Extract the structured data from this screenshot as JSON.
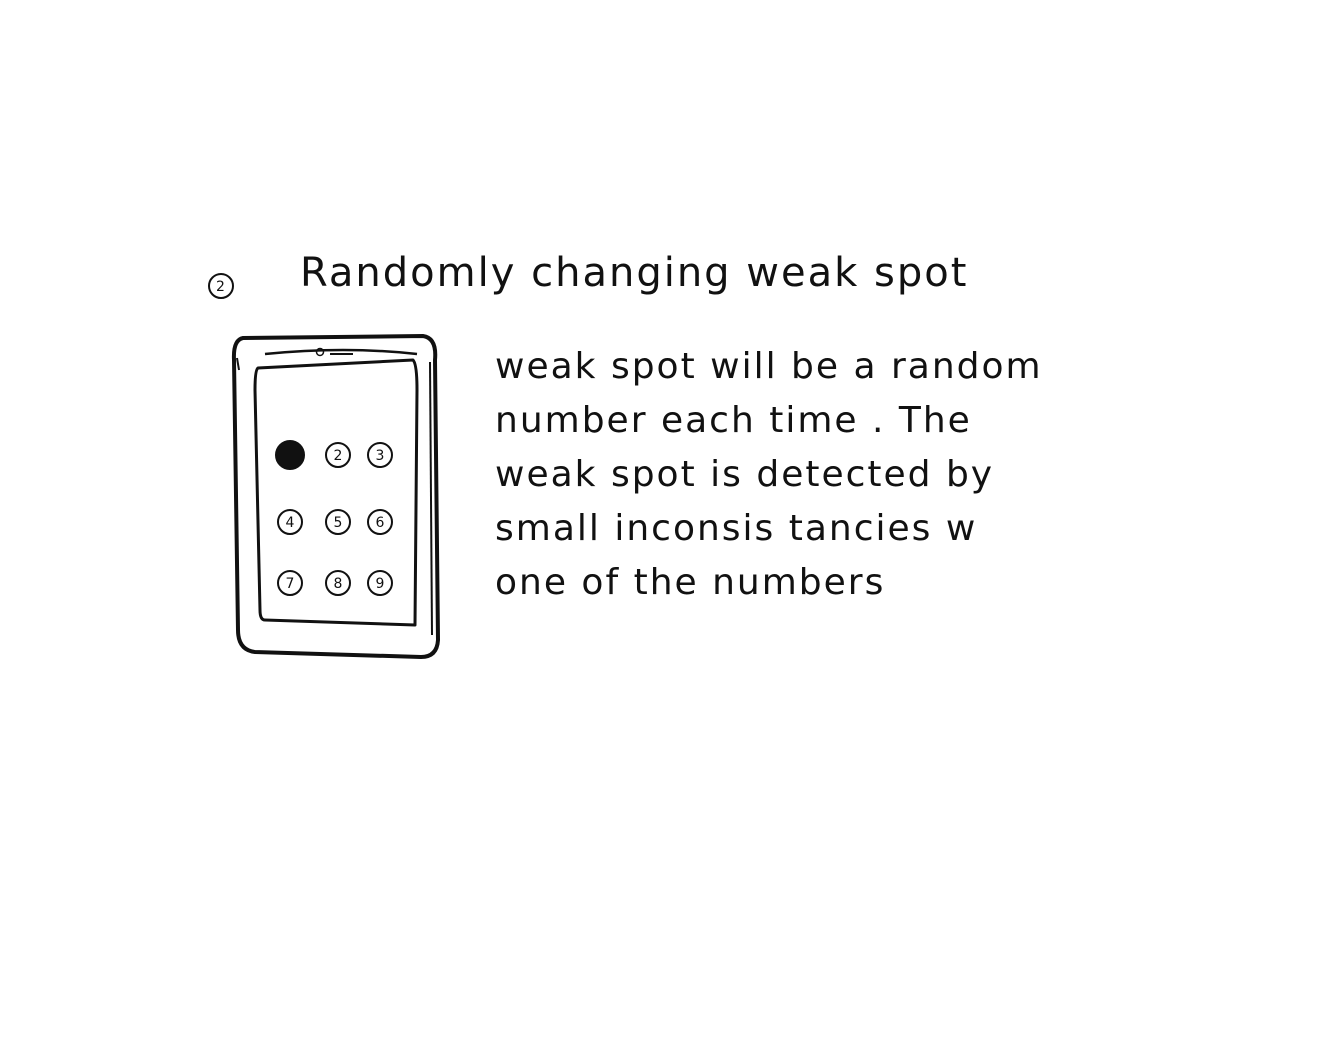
{
  "heading": {
    "number": "2",
    "text": "Randomly changing weak spot"
  },
  "description": {
    "lines": [
      "weak spot will be a random",
      "number each time . The",
      "weak spot is detected by",
      "small inconsis tancies w",
      "one of the numbers"
    ]
  },
  "tablet": {
    "keypad": [
      {
        "label": "",
        "filled": true
      },
      {
        "label": "2",
        "filled": false
      },
      {
        "label": "3",
        "filled": false
      },
      {
        "label": "4",
        "filled": false
      },
      {
        "label": "5",
        "filled": false
      },
      {
        "label": "6",
        "filled": false
      },
      {
        "label": "7",
        "filled": false
      },
      {
        "label": "8",
        "filled": false
      },
      {
        "label": "9",
        "filled": false
      }
    ]
  }
}
